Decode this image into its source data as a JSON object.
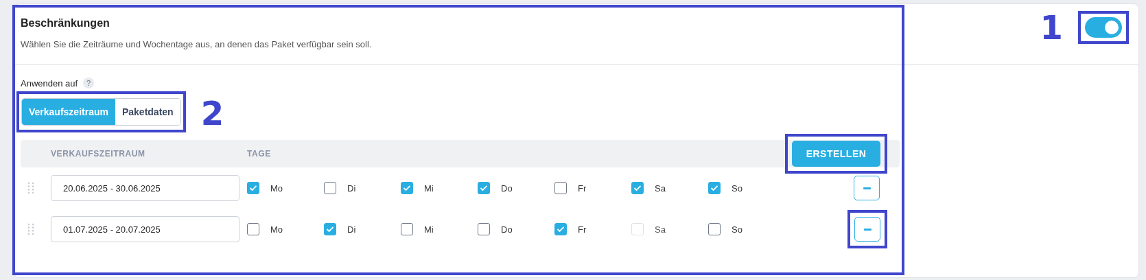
{
  "section": {
    "title": "Beschränkungen",
    "description": "Wählen Sie die Zeiträume und Wochentage aus, an denen das Paket verfügbar sein soll.",
    "highlighted": true,
    "enabled": true,
    "toggle_highlighted": true,
    "toggle_callout": "1"
  },
  "apply_to": {
    "label": "Anwenden auf",
    "help_icon": "?",
    "highlighted": true,
    "callout": "2",
    "options": [
      {
        "label": "Verkaufszeitraum",
        "selected": true
      },
      {
        "label": "Paketdaten",
        "selected": false
      }
    ]
  },
  "table": {
    "columns": [
      "VERKAUFSZEITRAUM",
      "TAGE"
    ],
    "create_button": {
      "label": "ERSTELLEN",
      "highlighted": true
    },
    "rows": [
      {
        "period": "20.06.2025 - 30.06.2025",
        "remove_highlighted": false,
        "days": [
          {
            "label": "Mo",
            "checked": true,
            "disabled": false
          },
          {
            "label": "Di",
            "checked": false,
            "disabled": false
          },
          {
            "label": "Mi",
            "checked": true,
            "disabled": false
          },
          {
            "label": "Do",
            "checked": true,
            "disabled": false
          },
          {
            "label": "Fr",
            "checked": false,
            "disabled": false
          },
          {
            "label": "Sa",
            "checked": true,
            "disabled": false
          },
          {
            "label": "So",
            "checked": true,
            "disabled": false
          }
        ]
      },
      {
        "period": "01.07.2025 - 20.07.2025",
        "remove_highlighted": true,
        "days": [
          {
            "label": "Mo",
            "checked": false,
            "disabled": false
          },
          {
            "label": "Di",
            "checked": true,
            "disabled": false
          },
          {
            "label": "Mi",
            "checked": false,
            "disabled": false
          },
          {
            "label": "Do",
            "checked": false,
            "disabled": false
          },
          {
            "label": "Fr",
            "checked": true,
            "disabled": false
          },
          {
            "label": "Sa",
            "checked": false,
            "disabled": true
          },
          {
            "label": "So",
            "checked": false,
            "disabled": false
          }
        ]
      }
    ]
  }
}
